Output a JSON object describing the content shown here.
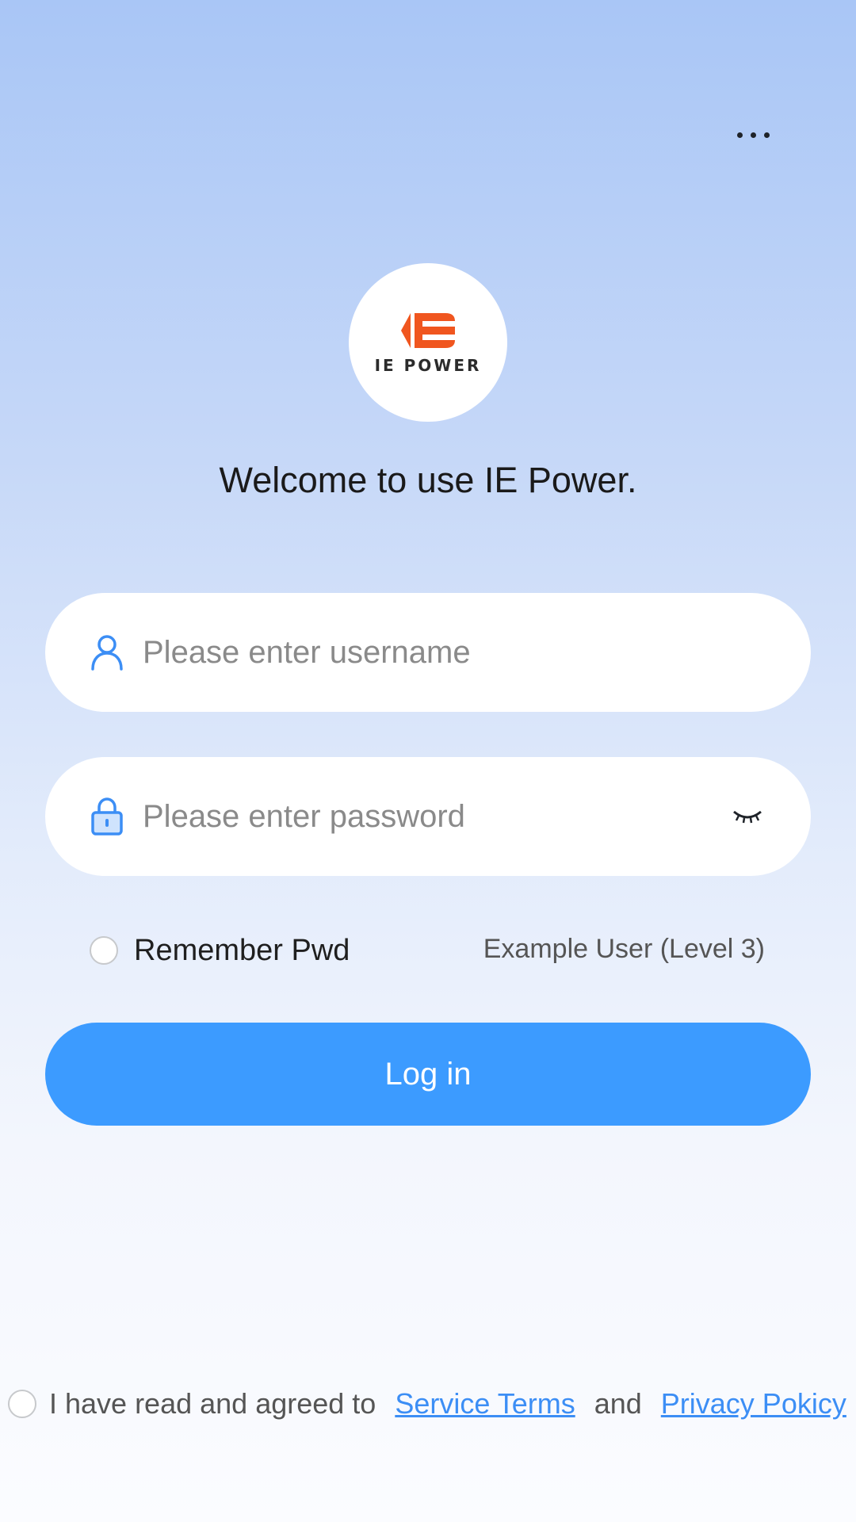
{
  "header": {
    "more_icon": "more-horizontal-icon"
  },
  "logo": {
    "brand_text": "IE POWER",
    "accent_color": "#f0561f"
  },
  "welcome_text": "Welcome to use IE Power.",
  "form": {
    "username_placeholder": "Please enter username",
    "password_placeholder": "Please enter password",
    "username_icon": "user-icon",
    "password_icon": "lock-icon",
    "toggle_icon": "eye-closed-icon",
    "remember_label": "Remember Pwd",
    "remember_checked": false,
    "example_user": "Example User (Level 3)",
    "login_label": "Log in"
  },
  "agreement": {
    "checked": false,
    "prefix": "I have read and agreed to",
    "service_terms": "Service Terms",
    "and_text": "and",
    "privacy_policy": "Privacy Pokicy"
  },
  "colors": {
    "primary": "#3c9bff",
    "link": "#3c8ef5",
    "icon": "#3c8ef5"
  }
}
